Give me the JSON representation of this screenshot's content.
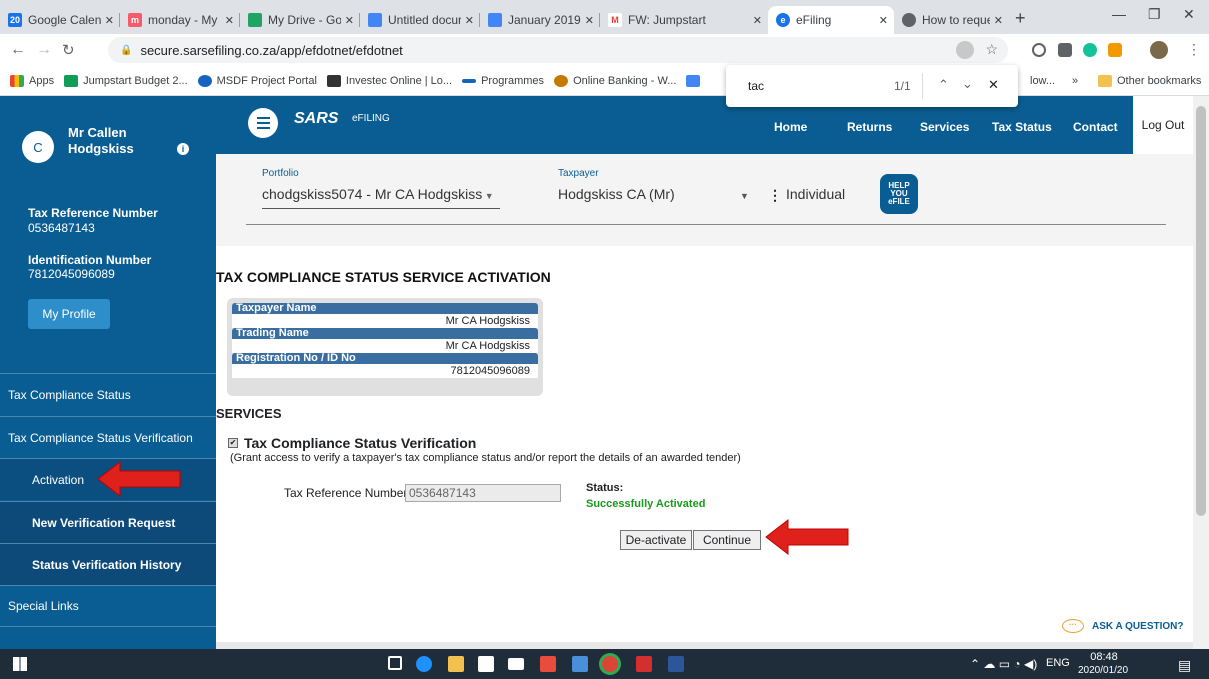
{
  "browser": {
    "tabs": [
      {
        "fav": "20",
        "favcolor": "#1a73e8",
        "title": "Google Calenc"
      },
      {
        "fav": "m",
        "favcolor": "#f65b6d",
        "title": "monday - My"
      },
      {
        "fav": "",
        "favcolor": "#1fa463",
        "title": "My Drive - Go"
      },
      {
        "fav": "",
        "favcolor": "#4285f4",
        "title": "Untitled docur"
      },
      {
        "fav": "",
        "favcolor": "#4285f4",
        "title": "January 2019 I"
      },
      {
        "fav": "M",
        "favcolor": "#ea4335",
        "title": "FW: Jumpstart"
      },
      {
        "fav": "e",
        "favcolor": "#1a73e8",
        "title": "eFiling"
      },
      {
        "fav": "",
        "favcolor": "#5f6368",
        "title": "How to reque"
      }
    ],
    "url": "secure.sarsefiling.co.za/app/efdotnet/efdotnet",
    "bookmarks": [
      "Apps",
      "Jumpstart Budget 2...",
      "MSDF Project Portal",
      "Investec Online | Lo...",
      "Programmes",
      "Online Banking - W...",
      "low...",
      "»",
      "Other bookmarks"
    ],
    "find": {
      "query": "tac",
      "count": "1/1"
    }
  },
  "user": {
    "initial": "C",
    "name": "Mr Callen Hodgskiss",
    "tax_ref_label": "Tax Reference Number",
    "tax_ref": "0536487143",
    "id_label": "Identification Number",
    "id": "7812045096089",
    "profile_btn": "My Profile"
  },
  "sidebar": {
    "items": [
      {
        "label": "Tax Compliance Status"
      },
      {
        "label": "Tax Compliance Status Verification"
      },
      {
        "label": "Activation"
      },
      {
        "label": "New Verification Request"
      },
      {
        "label": "Status Verification History"
      },
      {
        "label": "Special Links"
      }
    ]
  },
  "header": {
    "logo": "SARS",
    "logo_sub": "eFILING",
    "nav": [
      "Home",
      "Returns",
      "Services",
      "Tax Status",
      "Contact"
    ],
    "logout": "Log Out"
  },
  "portfolio": {
    "portfolio_label": "Portfolio",
    "portfolio_value": "chodgskiss5074 - Mr CA Hodgskiss",
    "taxpayer_label": "Taxpayer",
    "taxpayer_value": "Hodgskiss CA (Mr)",
    "type": "Individual",
    "help": "HELP YOU eFILE"
  },
  "page": {
    "title": "TAX COMPLIANCE STATUS SERVICE ACTIVATION",
    "info": [
      {
        "label": "Taxpayer Name",
        "value": "Mr CA Hodgskiss"
      },
      {
        "label": "Trading Name",
        "value": "Mr CA Hodgskiss"
      },
      {
        "label": "Registration No / ID No",
        "value": "7812045096089"
      }
    ],
    "services_heading": "SERVICES",
    "service_name": "Tax Compliance Status Verification",
    "service_desc": "(Grant access to verify a taxpayer's tax compliance status and/or report the details of an awarded tender)",
    "trn_label": "Tax Reference Number",
    "trn_value": "0536487143",
    "status_label": "Status:",
    "status_value": "Successfully Activated",
    "deactivate": "De-activate",
    "continue": "Continue",
    "ask": "ASK A QUESTION?"
  },
  "taskbar": {
    "time": "08:48",
    "date": "2020/01/20",
    "lang": "ENG"
  }
}
